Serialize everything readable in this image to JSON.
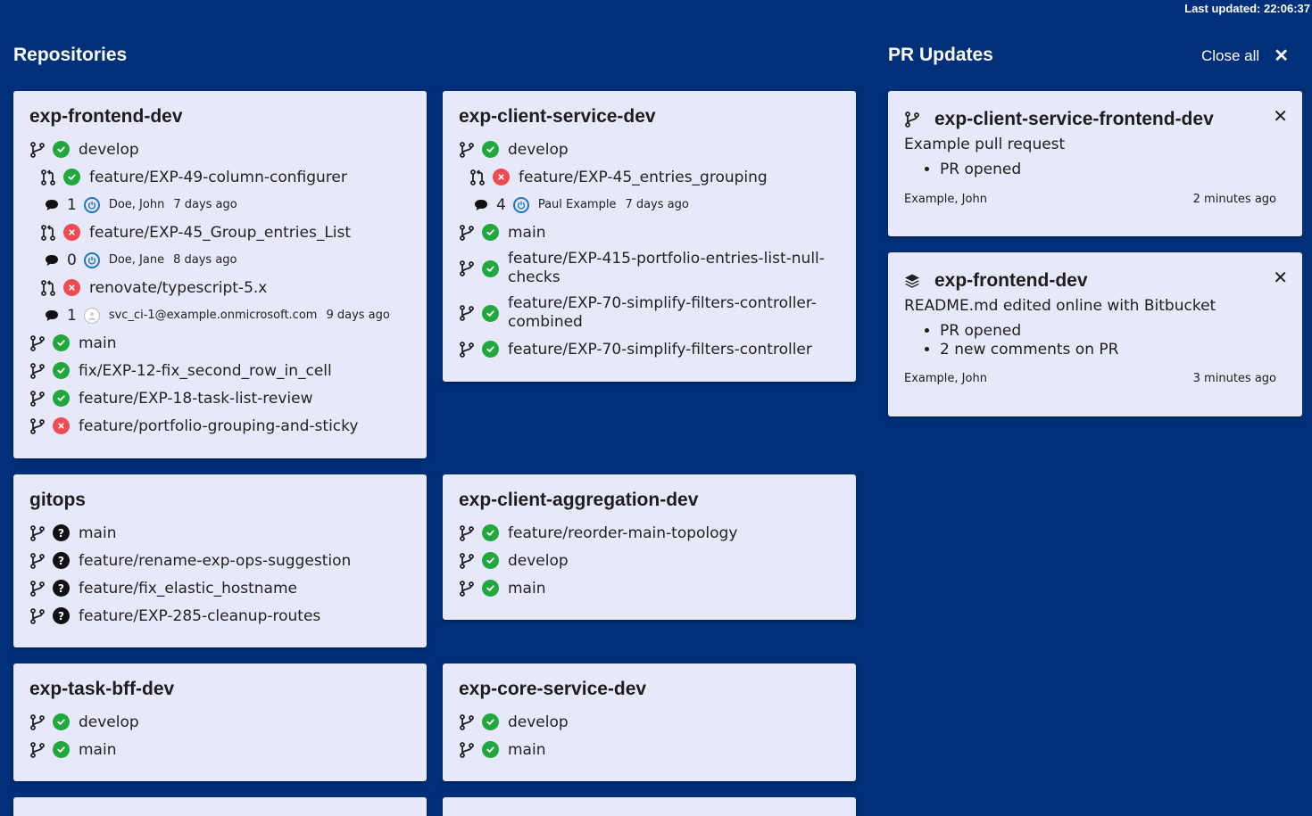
{
  "header": {
    "last_updated": "Last updated: 22:06:37"
  },
  "repositories": {
    "title": "Repositories",
    "cards": [
      {
        "name": "exp-frontend-dev",
        "rows": [
          {
            "kind": "branch",
            "status": "ok",
            "label": "develop"
          },
          {
            "kind": "pr",
            "status": "ok",
            "label": "feature/EXP-49-column-configurer"
          },
          {
            "kind": "meta",
            "comments": "1",
            "author": "Doe, John",
            "age": "7 days ago",
            "avatar": "blue"
          },
          {
            "kind": "pr",
            "status": "fail",
            "label": "feature/EXP-45_Group_entries_List"
          },
          {
            "kind": "meta",
            "comments": "0",
            "author": "Doe, Jane",
            "age": "8 days ago",
            "avatar": "blue"
          },
          {
            "kind": "pr",
            "status": "fail",
            "label": "renovate/typescript-5.x"
          },
          {
            "kind": "meta",
            "comments": "1",
            "author": "svc_ci-1@example.onmicrosoft.com",
            "age": "9 days ago",
            "avatar": "grey"
          },
          {
            "kind": "branch",
            "status": "ok",
            "label": "main"
          },
          {
            "kind": "branch",
            "status": "ok",
            "label": "fix/EXP-12-fix_second_row_in_cell"
          },
          {
            "kind": "branch",
            "status": "ok",
            "label": "feature/EXP-18-task-list-review"
          },
          {
            "kind": "branch",
            "status": "fail",
            "label": "feature/portfolio-grouping-and-sticky"
          }
        ]
      },
      {
        "name": "exp-client-service-dev",
        "rows": [
          {
            "kind": "branch",
            "status": "ok",
            "label": "develop"
          },
          {
            "kind": "pr",
            "status": "fail",
            "label": "feature/EXP-45_entries_grouping"
          },
          {
            "kind": "meta",
            "comments": "4",
            "author": "Paul Example",
            "age": "7 days ago",
            "avatar": "blue"
          },
          {
            "kind": "branch",
            "status": "ok",
            "label": "main"
          },
          {
            "kind": "branch",
            "status": "ok",
            "label": "feature/EXP-415-portfolio-entries-list-null-\nchecks",
            "tall": true
          },
          {
            "kind": "branch",
            "status": "ok",
            "label": "feature/EXP-70-simplify-filters-controller-\ncombined",
            "tall": true
          },
          {
            "kind": "branch",
            "status": "ok",
            "label": "feature/EXP-70-simplify-filters-controller"
          }
        ]
      },
      {
        "name": "gitops",
        "rows": [
          {
            "kind": "branch",
            "status": "unknown",
            "label": "main"
          },
          {
            "kind": "branch",
            "status": "unknown",
            "label": "feature/rename-exp-ops-suggestion"
          },
          {
            "kind": "branch",
            "status": "unknown",
            "label": "feature/fix_elastic_hostname"
          },
          {
            "kind": "branch",
            "status": "unknown",
            "label": "feature/EXP-285-cleanup-routes"
          }
        ]
      },
      {
        "name": "exp-client-aggregation-dev",
        "rows": [
          {
            "kind": "branch",
            "status": "ok",
            "label": "feature/reorder-main-topology"
          },
          {
            "kind": "branch",
            "status": "ok",
            "label": "develop"
          },
          {
            "kind": "branch",
            "status": "ok",
            "label": "main"
          }
        ]
      },
      {
        "name": "exp-task-bff-dev",
        "rows": [
          {
            "kind": "branch",
            "status": "ok",
            "label": "develop"
          },
          {
            "kind": "branch",
            "status": "ok",
            "label": "main"
          }
        ]
      },
      {
        "name": "exp-core-service-dev",
        "rows": [
          {
            "kind": "branch",
            "status": "ok",
            "label": "develop"
          },
          {
            "kind": "branch",
            "status": "ok",
            "label": "main"
          }
        ]
      }
    ]
  },
  "pr_updates": {
    "title": "PR Updates",
    "close_all_label": "Close all",
    "close_glyph": "✕",
    "items": [
      {
        "icon": "branch-icon",
        "repo": "exp-client-service-frontend-dev",
        "description": "Example pull request",
        "events": [
          "PR opened"
        ],
        "author": "Example, John",
        "age": "2 minutes ago"
      },
      {
        "icon": "layers-icon",
        "repo": "exp-frontend-dev",
        "description": "README.md edited online with Bitbucket",
        "events": [
          "PR opened",
          "2 new comments on PR"
        ],
        "author": "Example, John",
        "age": "3 minutes ago"
      }
    ]
  },
  "colors": {
    "background": "#00307a",
    "card": "#e8e8fb",
    "ok": "#21a83c",
    "fail": "#ee4b52",
    "unknown": "#111111",
    "avatar": "#1b76c7"
  }
}
